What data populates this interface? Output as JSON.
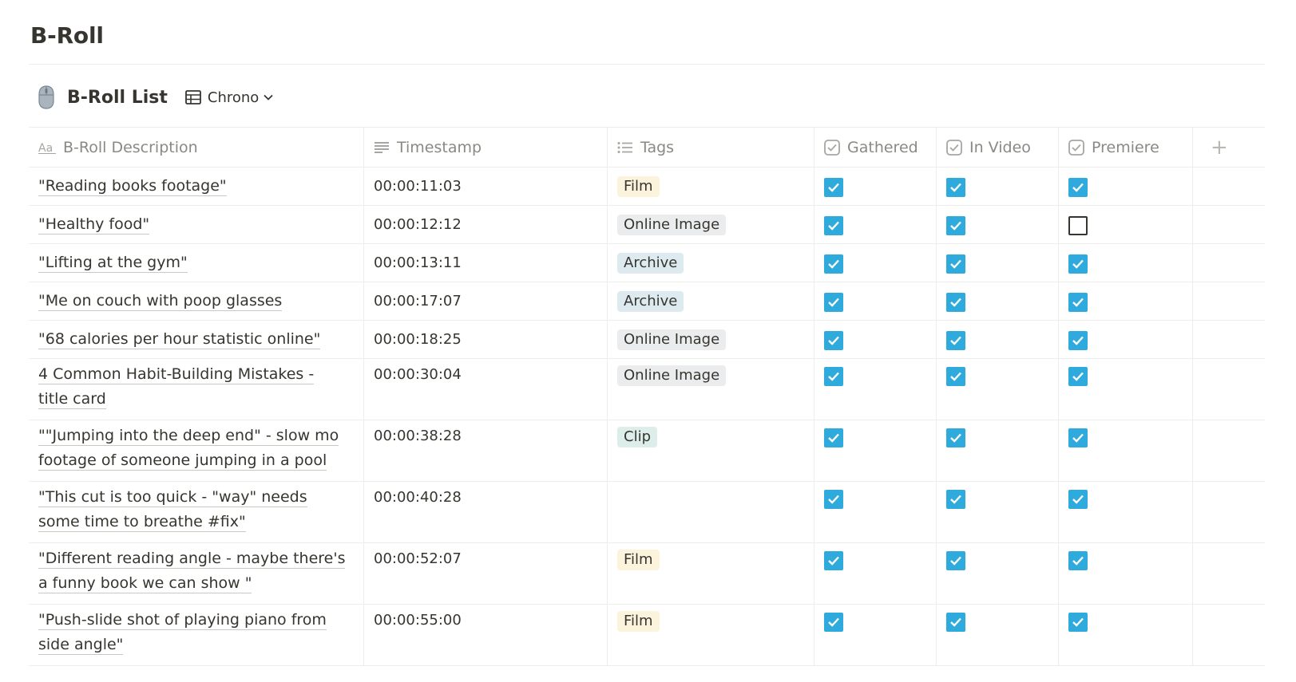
{
  "page": {
    "title": "B-Roll"
  },
  "database": {
    "title": "B-Roll List",
    "view_label": "Chrono",
    "icon": "computer-mouse-icon"
  },
  "columns": [
    {
      "label": "B-Roll Description",
      "icon": "text-aa-icon"
    },
    {
      "label": "Timestamp",
      "icon": "text-lines-icon"
    },
    {
      "label": "Tags",
      "icon": "list-icon"
    },
    {
      "label": "Gathered",
      "icon": "checkbox-icon"
    },
    {
      "label": "In Video",
      "icon": "checkbox-icon"
    },
    {
      "label": "Premiere",
      "icon": "checkbox-icon"
    }
  ],
  "add_column_label": "+",
  "tag_colors": {
    "Film": {
      "bg": "#fbf3db",
      "fg": "#37352f"
    },
    "Online Image": {
      "bg": "#ebeced",
      "fg": "#37352f"
    },
    "Archive": {
      "bg": "#ddebf1",
      "fg": "#37352f"
    },
    "Clip": {
      "bg": "#ddedea",
      "fg": "#37352f"
    }
  },
  "checkbox_color": "#2eaadc",
  "rows": [
    {
      "lines": [
        "\"Reading books footage\""
      ],
      "timestamp": "00:00:11:03",
      "tag": "Film",
      "gathered": true,
      "in_video": true,
      "premiere": true
    },
    {
      "lines": [
        "\"Healthy food\""
      ],
      "timestamp": "00:00:12:12",
      "tag": "Online Image",
      "gathered": true,
      "in_video": true,
      "premiere": false
    },
    {
      "lines": [
        "\"Lifting at the gym\""
      ],
      "timestamp": "00:00:13:11",
      "tag": "Archive",
      "gathered": true,
      "in_video": true,
      "premiere": true
    },
    {
      "lines": [
        "\"Me on couch with poop glasses"
      ],
      "timestamp": "00:00:17:07",
      "tag": "Archive",
      "gathered": true,
      "in_video": true,
      "premiere": true
    },
    {
      "lines": [
        "\"68 calories per hour statistic online\""
      ],
      "timestamp": "00:00:18:25",
      "tag": "Online Image",
      "gathered": true,
      "in_video": true,
      "premiere": true
    },
    {
      "lines": [
        "4 Common Habit-Building Mistakes -",
        "title card"
      ],
      "timestamp": "00:00:30:04",
      "tag": "Online Image",
      "gathered": true,
      "in_video": true,
      "premiere": true
    },
    {
      "lines": [
        "\"\"Jumping into the deep end\" - slow mo",
        "footage of someone jumping in a pool"
      ],
      "timestamp": "00:00:38:28",
      "tag": "Clip",
      "gathered": true,
      "in_video": true,
      "premiere": true
    },
    {
      "lines": [
        "\"This cut is too quick - \"way\" needs",
        "some time to breathe #fix\""
      ],
      "timestamp": "00:00:40:28",
      "tag": "",
      "gathered": true,
      "in_video": true,
      "premiere": true
    },
    {
      "lines": [
        "\"Different reading angle - maybe there's",
        "a funny book we can show \""
      ],
      "timestamp": "00:00:52:07",
      "tag": "Film",
      "gathered": true,
      "in_video": true,
      "premiere": true
    },
    {
      "lines": [
        "\"Push-slide shot of playing piano from",
        "side angle\""
      ],
      "timestamp": "00:00:55:00",
      "tag": "Film",
      "gathered": true,
      "in_video": true,
      "premiere": true
    }
  ]
}
